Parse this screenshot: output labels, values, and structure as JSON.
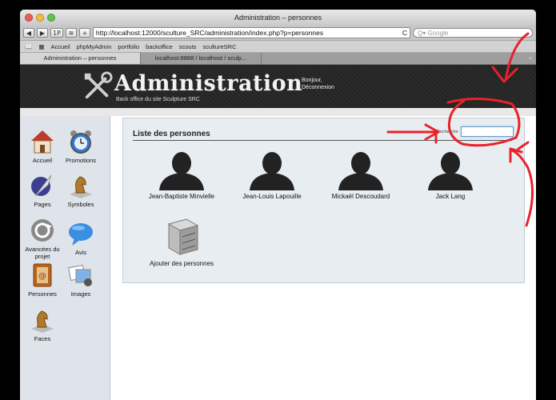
{
  "window": {
    "title": "Administration – personnes"
  },
  "toolbar": {
    "back": "◀",
    "forward": "▶",
    "onepassword": "1P",
    "rss": "≋",
    "add": "+",
    "url": "http://localhost:12000/sculture_SRC/administration/index.php?p=personnes",
    "reload": "C",
    "search_placeholder": "Q▾ Google"
  },
  "bookmarks": {
    "items": [
      "Accueil",
      "phpMyAdmin",
      "portfolio",
      "backoffice",
      "scouts",
      "scultureSRC"
    ]
  },
  "tabs": [
    "Administration – personnes",
    "localhost:8888 / localhost / sculp..."
  ],
  "header": {
    "title": "Administration",
    "subtitle": "Back office du site Sculpture SRC",
    "greeting": "Bonjour,",
    "logout": "Déconnexion"
  },
  "sidebar": {
    "items": [
      {
        "label": "Accueil",
        "icon": "home-icon"
      },
      {
        "label": "Promotions",
        "icon": "alarm-clock-icon"
      },
      {
        "label": "Pages",
        "icon": "quill-icon"
      },
      {
        "label": "Symboles",
        "icon": "chess-knight-icon"
      },
      {
        "label": "Avancées du projet",
        "icon": "refresh-icon"
      },
      {
        "label": "Avis",
        "icon": "speech-bubble-icon"
      },
      {
        "label": "Personnes",
        "icon": "address-book-icon"
      },
      {
        "label": "Images",
        "icon": "photos-icon"
      },
      {
        "label": "Faces",
        "icon": "chess-knight-icon"
      }
    ]
  },
  "main": {
    "section_title": "Liste des personnes",
    "search_label": "Recherche",
    "persons": [
      {
        "name": "Jean-Baptiste Minvielle"
      },
      {
        "name": "Jean-Louis Lapouille"
      },
      {
        "name": "Mickaël Descoudard"
      },
      {
        "name": "Jack Lang"
      }
    ],
    "add_label": "Ajouter des personnes"
  },
  "colors": {
    "annotation": "#e8222b",
    "header_bg": "#2a2a2a",
    "panel_bg": "#e8edf2"
  }
}
